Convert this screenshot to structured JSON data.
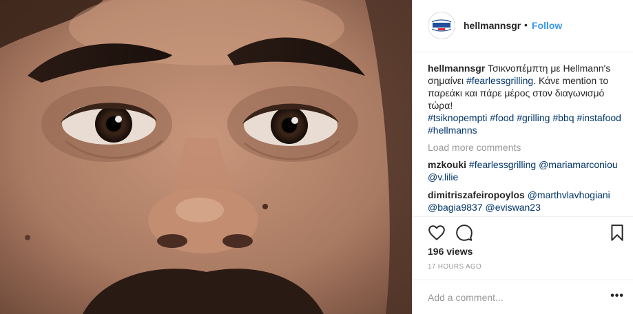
{
  "post": {
    "image_alt_icon": "face-photo",
    "header": {
      "avatar_icon": "hellmanns-logo-icon",
      "username": "hellmannsgr",
      "separator": "•",
      "follow_label": "Follow"
    },
    "caption": {
      "username": "hellmannsgr",
      "text_before_tag": " Τσικνοπέμπτη με Hellmann's σημαίνει ",
      "tag1": "#fearlessgrilling",
      "text_after_tag": ". Κάνε mention το παρεάκι και πάρε μέρος στον διαγωνισμό τώρα!",
      "hashtags": "#tsiknopempti #food #grilling #bbq #instafood #hellmanns"
    },
    "load_more_label": "Load more comments",
    "comments": [
      {
        "username": "mzkouki",
        "text": "#fearlessgrilling @mariamarconiou @v.lilie"
      },
      {
        "username": "dimitriszafeiropoylos",
        "text": "@marthvlavhogiani @bagia9837 @eviswan23"
      }
    ],
    "views": "196 views",
    "timestamp": "17 HOURS AGO",
    "add_comment_placeholder": "Add a comment...",
    "more_glyph": "•••"
  },
  "colors": {
    "link_blue": "#3897f0",
    "hashtag": "#003569",
    "muted": "#999999",
    "text": "#262626",
    "brand_blue": "#1f4f9d"
  }
}
